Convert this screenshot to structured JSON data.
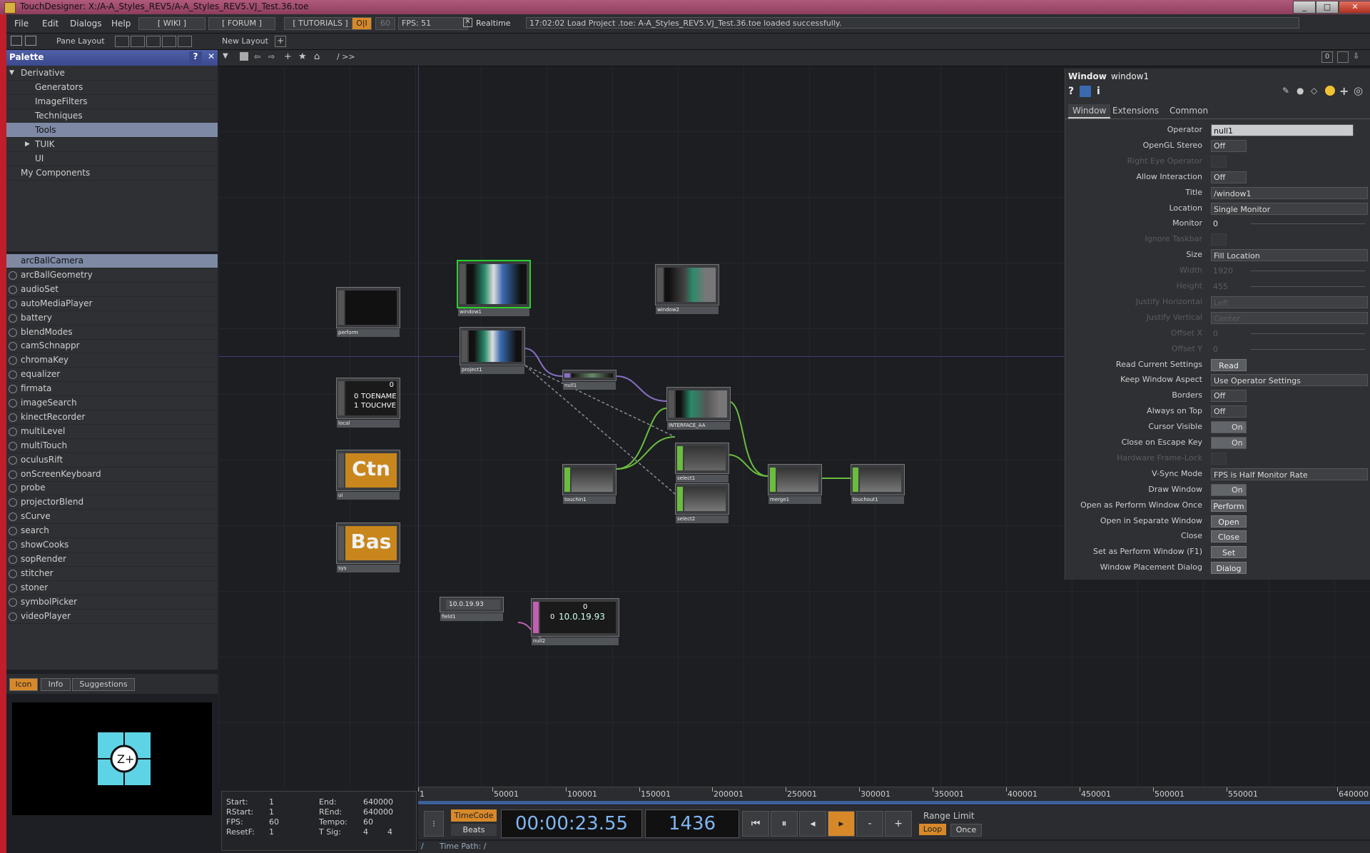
{
  "window": {
    "title": "TouchDesigner: X:/A-A_Styles_REV5/A-A_Styles_REV5.VJ_Test.36.toe",
    "min": "_",
    "max": "□",
    "close": "✕"
  },
  "menubar": {
    "items": [
      "File",
      "Edit",
      "Dialogs",
      "Help"
    ],
    "wiki": "[ WIKI ]",
    "forum": "[ FORUM ]",
    "tutorials": "[ TUTORIALS ]",
    "oi": "O|I",
    "fps_target": "60",
    "fps": "FPS:  51",
    "realtime": "Realtime",
    "status": "17:02:02 Load Project .toe: A-A_Styles_REV5.VJ_Test.36.toe loaded successfully."
  },
  "toolbar2": {
    "pane_layout": "Pane Layout",
    "new_layout": "New Layout",
    "path": "/  >>",
    "zero": "0"
  },
  "palette": {
    "title": "Palette",
    "tree": [
      {
        "label": "Derivative",
        "indent": 0
      },
      {
        "label": "Generators",
        "indent": 2
      },
      {
        "label": "ImageFilters",
        "indent": 2
      },
      {
        "label": "Techniques",
        "indent": 2
      },
      {
        "label": "Tools",
        "indent": 2
      },
      {
        "label": "TUIK",
        "indent": 2
      },
      {
        "label": "UI",
        "indent": 2
      },
      {
        "label": "My Components",
        "indent": 1
      }
    ],
    "items": [
      "arcBallCamera",
      "arcBallGeometry",
      "audioSet",
      "autoMediaPlayer",
      "battery",
      "blendModes",
      "camSchnappr",
      "chromaKey",
      "equalizer",
      "firmata",
      "imageSearch",
      "kinectRecorder",
      "multiLevel",
      "multiTouch",
      "oculusRift",
      "onScreenKeyboard",
      "probe",
      "projectorBlend",
      "sCurve",
      "search",
      "showCooks",
      "sopRender",
      "stitcher",
      "stoner",
      "symbolPicker",
      "videoPlayer"
    ],
    "tabs": {
      "icon": "Icon",
      "info": "Info",
      "suggestions": "Suggestions"
    }
  },
  "nodes": {
    "perform": "perform",
    "window1": "window1",
    "window2": "window2",
    "project1": "project1",
    "null1": "null1",
    "local": "local",
    "interface": "INTERFACE_AA",
    "ui": "ui",
    "sys": "sys",
    "touchin1": "touchin1",
    "select1": "select1",
    "select2": "select2",
    "merge1": "merge1",
    "touchout1": "touchout1",
    "field1": "field1",
    "null2": "null2",
    "local_text_0": "0",
    "local_text_1": "TOENAME",
    "local_text_2": "TOUCHVE",
    "local_idx0": "0",
    "local_idx1": "1",
    "ctn": "Ctn",
    "bas": "Bas",
    "field_value": "10.0.19.93",
    "null2_value": "10.0.19.93",
    "null2_idx": "0",
    "null2_top": "0"
  },
  "params": {
    "type": "Window",
    "name": "window1",
    "tabs": [
      "Window",
      "Extensions",
      "Common"
    ],
    "rows": [
      {
        "label": "Operator",
        "value": "null1",
        "kind": "field"
      },
      {
        "label": "OpenGL Stereo",
        "value": "Off",
        "kind": "toggle"
      },
      {
        "label": "Right Eye Operator",
        "value": "",
        "kind": "dim"
      },
      {
        "label": "Allow Interaction",
        "value": "Off",
        "kind": "toggle"
      },
      {
        "label": "Title",
        "value": "/window1",
        "kind": "field"
      },
      {
        "label": "Location",
        "value": "Single Monitor",
        "kind": "menu"
      },
      {
        "label": "Monitor",
        "value": "0",
        "kind": "slider"
      },
      {
        "label": "Ignore Taskbar",
        "value": "",
        "kind": "dim"
      },
      {
        "label": "Size",
        "value": "Fill Location",
        "kind": "menu"
      },
      {
        "label": "Width",
        "value": "1920",
        "kind": "dimslider"
      },
      {
        "label": "Height",
        "value": "455",
        "kind": "dimslider"
      },
      {
        "label": "Justify Horizontal",
        "value": "Left",
        "kind": "dimmenu"
      },
      {
        "label": "Justify Vertical",
        "value": "Center",
        "kind": "dimmenu"
      },
      {
        "label": "Offset X",
        "value": "0",
        "kind": "dimslider"
      },
      {
        "label": "Offset Y",
        "value": "0",
        "kind": "dimslider"
      },
      {
        "label": "Read Current Settings",
        "value": "Read",
        "kind": "button"
      },
      {
        "label": "Keep Window Aspect",
        "value": "Use Operator Settings",
        "kind": "menu"
      },
      {
        "label": "Borders",
        "value": "Off",
        "kind": "toggle"
      },
      {
        "label": "Always on Top",
        "value": "Off",
        "kind": "toggle"
      },
      {
        "label": "Cursor Visible",
        "value": "On",
        "kind": "toggleon"
      },
      {
        "label": "Close on Escape Key",
        "value": "On",
        "kind": "toggleon"
      },
      {
        "label": "Hardware Frame-Lock",
        "value": "",
        "kind": "dim"
      },
      {
        "label": "V-Sync Mode",
        "value": "FPS is Half Monitor Rate",
        "kind": "menu"
      },
      {
        "label": "Draw Window",
        "value": "On",
        "kind": "toggleon"
      },
      {
        "label": "Open as Perform Window Once",
        "value": "Perform",
        "kind": "button"
      },
      {
        "label": "Open in Separate Window",
        "value": "Open",
        "kind": "button"
      },
      {
        "label": "Close",
        "value": "Close",
        "kind": "button"
      },
      {
        "label": "Set as Perform Window (F1)",
        "value": "Set",
        "kind": "button"
      },
      {
        "label": "Window Placement Dialog",
        "value": "Dialog",
        "kind": "button"
      }
    ]
  },
  "timeline": {
    "ticks": [
      "1",
      "50001",
      "100001",
      "150001",
      "200001",
      "250001",
      "300001",
      "350001",
      "400001",
      "450001",
      "500001",
      "550001",
      "640000"
    ]
  },
  "timeinfo": {
    "start_l": "Start:",
    "start": "1",
    "end_l": "End:",
    "end": "640000",
    "rstart_l": "RStart:",
    "rstart": "1",
    "rend_l": "REnd:",
    "rend": "640000",
    "fps_l": "FPS:",
    "fps": "60",
    "tempo_l": "Tempo:",
    "tempo": "60",
    "resetf_l": "ResetF:",
    "resetf": "1",
    "tsig_l": "T Sig:",
    "tsig_a": "4",
    "tsig_b": "4"
  },
  "transport": {
    "timecode_label": "TimeCode",
    "beats_label": "Beats",
    "timecode": "00:00:23.55",
    "frame": "1436",
    "range_limit": "Range Limit",
    "loop": "Loop",
    "once": "Once",
    "time_path": "Time Path: /"
  }
}
